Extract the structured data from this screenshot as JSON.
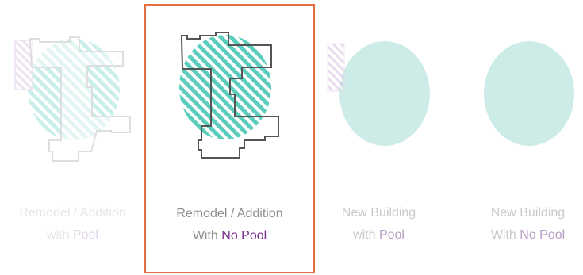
{
  "colors": {
    "selected_border": "#e2703f",
    "teal": "#5ccdbd",
    "teal_light": "#cdece8",
    "purple_hatch": "#c9a6d6",
    "outline": "#555555",
    "text": "#8e8e8e",
    "accent": "#7a2a8c"
  },
  "options": [
    {
      "line1": "Remodel / Addition",
      "line2_prefix": "with ",
      "line2_accent": "Pool",
      "selected": false,
      "icon": "remodel-with-pool-icon"
    },
    {
      "line1": "Remodel / Addition",
      "line2_prefix": "With ",
      "line2_accent": "No Pool",
      "selected": true,
      "icon": "remodel-no-pool-icon"
    },
    {
      "line1": "New Building",
      "line2_prefix": "with ",
      "line2_accent": "Pool",
      "selected": false,
      "icon": "new-building-with-pool-icon"
    },
    {
      "line1": "New Building",
      "line2_prefix": "With ",
      "line2_accent": "No Pool",
      "selected": false,
      "icon": "new-building-no-pool-icon"
    }
  ]
}
